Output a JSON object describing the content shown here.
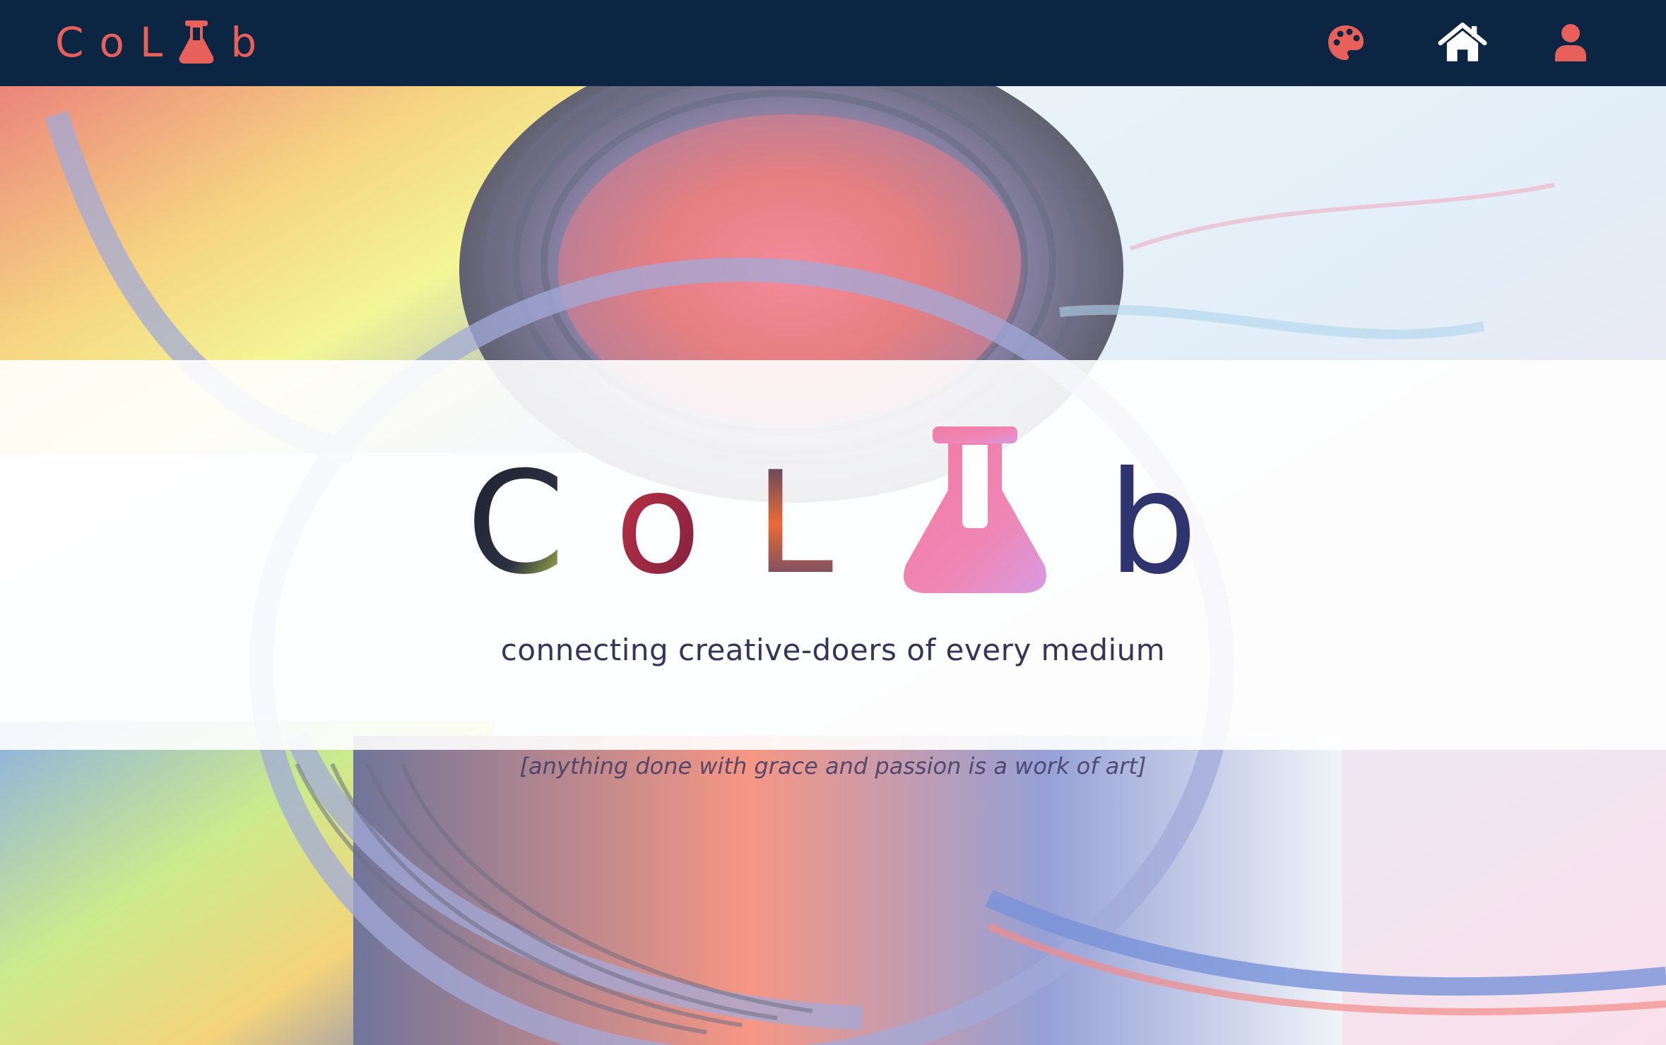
{
  "brand": {
    "letters_before": [
      "C",
      "o",
      "L"
    ],
    "letters_after": [
      "b"
    ],
    "logo_icon": "flask-icon",
    "color": "#e8605a"
  },
  "nav": {
    "background": "#0b2542",
    "icons": [
      {
        "id": "palette",
        "icon": "palette-icon",
        "color": "#e8605a"
      },
      {
        "id": "home",
        "icon": "home-icon",
        "color": "#ffffff"
      },
      {
        "id": "user",
        "icon": "user-icon",
        "color": "#e8605a"
      }
    ]
  },
  "hero": {
    "title_letters_before": [
      "C",
      "o",
      "L"
    ],
    "title_letters_after": [
      "b"
    ],
    "title_icon": "flask-icon",
    "tagline": "connecting creative-doers of every medium",
    "quote": "[anything done with grace and passion is a work of art]"
  }
}
